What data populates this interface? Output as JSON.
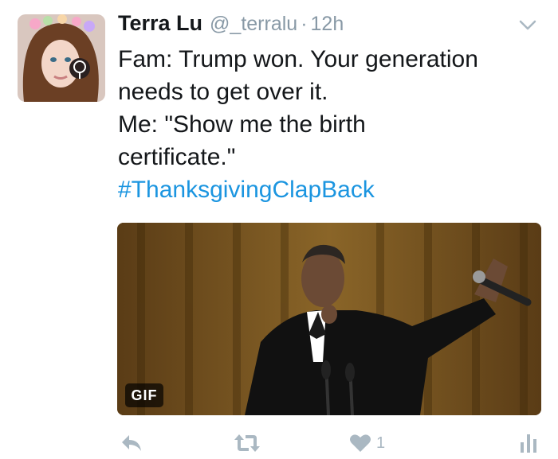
{
  "tweet": {
    "author_name": "Terra Lu",
    "handle": "@_terralu",
    "separator": "·",
    "time": "12h",
    "lines": [
      "Fam: Trump won. Your generation",
      "needs to get over it.",
      "Me: \"Show me the birth",
      "certificate.\""
    ],
    "hashtag": "#ThanksgivingClapBack",
    "media": {
      "badge": "GIF"
    },
    "actions": {
      "like_count": "1"
    }
  },
  "colors": {
    "text": "#14171a",
    "secondary": "#8899a6",
    "link": "#1b95e0",
    "action_icon": "#aab8c2"
  },
  "icons": [
    "avatar",
    "chevron-down-icon",
    "reply-icon",
    "retweet-icon",
    "heart-icon",
    "analytics-icon"
  ]
}
